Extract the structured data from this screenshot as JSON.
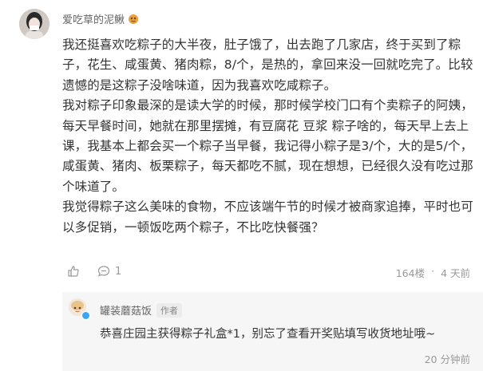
{
  "comment": {
    "username": "爱吃草的泥鳅",
    "paragraphs": [
      "我还挺喜欢吃粽子的大半夜，肚子饿了，出去跑了几家店，终于买到了粽子，花生、咸蛋黄、猪肉粽，8/个，是热的，拿回来没一回就吃完了。比较遗憾的是这粽子没啥味道，因为我喜欢吃咸粽子。",
      "我对粽子印象最深的是读大学的时候，那时候学校门口有个卖粽子的阿姨，每天早餐时间，她就在那里摆摊，有豆腐花 豆浆 粽子啥的，每天早上去上课，我基本上都会买一个粽子当早餐，我记得小粽子是3/个，大的是5/个，咸蛋黄、猪肉、板栗粽子，每天都吃不腻，现在想想，已经很久没有吃过那个味道了。",
      "我觉得粽子这么美味的食物，不应该端午节的时候才被商家追捧，平时也可以多促销，一顿饭吃两个粽子，不比吃快餐强？"
    ],
    "like_icon": "thumbs-up-icon",
    "reply_icon": "comment-icon",
    "reply_count": "1",
    "floor": "164楼",
    "separator": "·",
    "time": "4 天前"
  },
  "reply": {
    "username": "罐装蘑菇饭",
    "tag": "作者",
    "text": "恭喜庄园主获得粽子礼盒*1，别忘了查看开奖贴填写收货地址哦~",
    "time": "20 分钟前"
  },
  "colors": {
    "text": "#333333",
    "muted": "#999999",
    "reply_bg": "#f6f6f6",
    "verified": "#3aa5f5"
  }
}
